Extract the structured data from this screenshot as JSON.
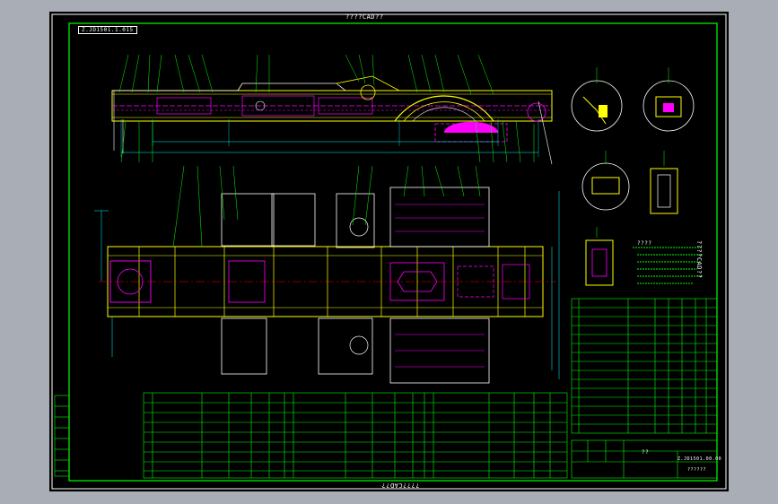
{
  "sheet": {
    "top_title": "????CAD??",
    "bottom_title": "????CAD??",
    "side_title": "????CAD??",
    "sheet_code": "Z.JD1501.1.015",
    "section_title": "????",
    "title_block": {
      "name": "??",
      "drawing_no": "Z.JD1501.00.00",
      "scale": "??????"
    }
  },
  "colors": {
    "background": "#000000",
    "frame": "#00ff00",
    "outline": "#ffff00",
    "hidden": "#ff00ff",
    "centerline": "#ff0000",
    "dimension": "#00ffff",
    "text": "#ffffff",
    "viewer_bg": "#a9adb6"
  }
}
